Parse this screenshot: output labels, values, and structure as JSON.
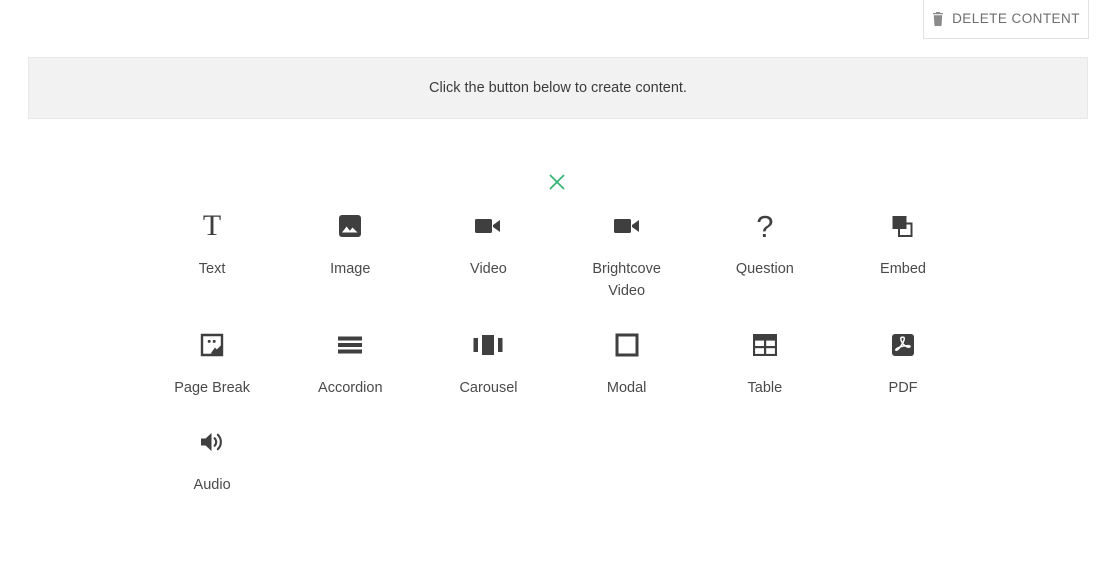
{
  "toolbar": {
    "delete_content_label": "DELETE CONTENT",
    "delete_icon": "trash-icon"
  },
  "banner": {
    "message": "Click the button below to create content."
  },
  "picker": {
    "close_icon": "close-x-icon",
    "close_color": "#34b474",
    "icon_color": "#3f3f3f",
    "tiles": [
      {
        "label": "Text",
        "icon": "text-icon"
      },
      {
        "label": "Image",
        "icon": "image-icon"
      },
      {
        "label": "Video",
        "icon": "video-icon"
      },
      {
        "label": "Brightcove Video",
        "icon": "brightcove-video-icon"
      },
      {
        "label": "Question",
        "icon": "question-icon"
      },
      {
        "label": "Embed",
        "icon": "embed-icon"
      },
      {
        "label": "Page Break",
        "icon": "page-break-icon"
      },
      {
        "label": "Accordion",
        "icon": "accordion-icon"
      },
      {
        "label": "Carousel",
        "icon": "carousel-icon"
      },
      {
        "label": "Modal",
        "icon": "modal-icon"
      },
      {
        "label": "Table",
        "icon": "table-icon"
      },
      {
        "label": "PDF",
        "icon": "pdf-icon"
      },
      {
        "label": "Audio",
        "icon": "audio-icon"
      }
    ]
  }
}
